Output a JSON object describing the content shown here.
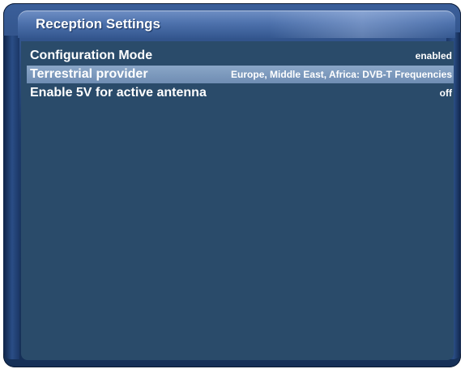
{
  "window": {
    "title": "Reception Settings"
  },
  "settings": [
    {
      "label": "Configuration Mode",
      "value": "enabled",
      "selected": false
    },
    {
      "label": "Terrestrial provider",
      "value": "Europe, Middle East, Africa: DVB-T Frequencies",
      "selected": true
    },
    {
      "label": "Enable 5V for active antenna",
      "value": "off",
      "selected": false
    }
  ],
  "colors": {
    "content_background": "#2a4b6a",
    "selection_highlight": "#7b97bc",
    "title_bar": "#4e72ad",
    "text": "#ffffff"
  }
}
